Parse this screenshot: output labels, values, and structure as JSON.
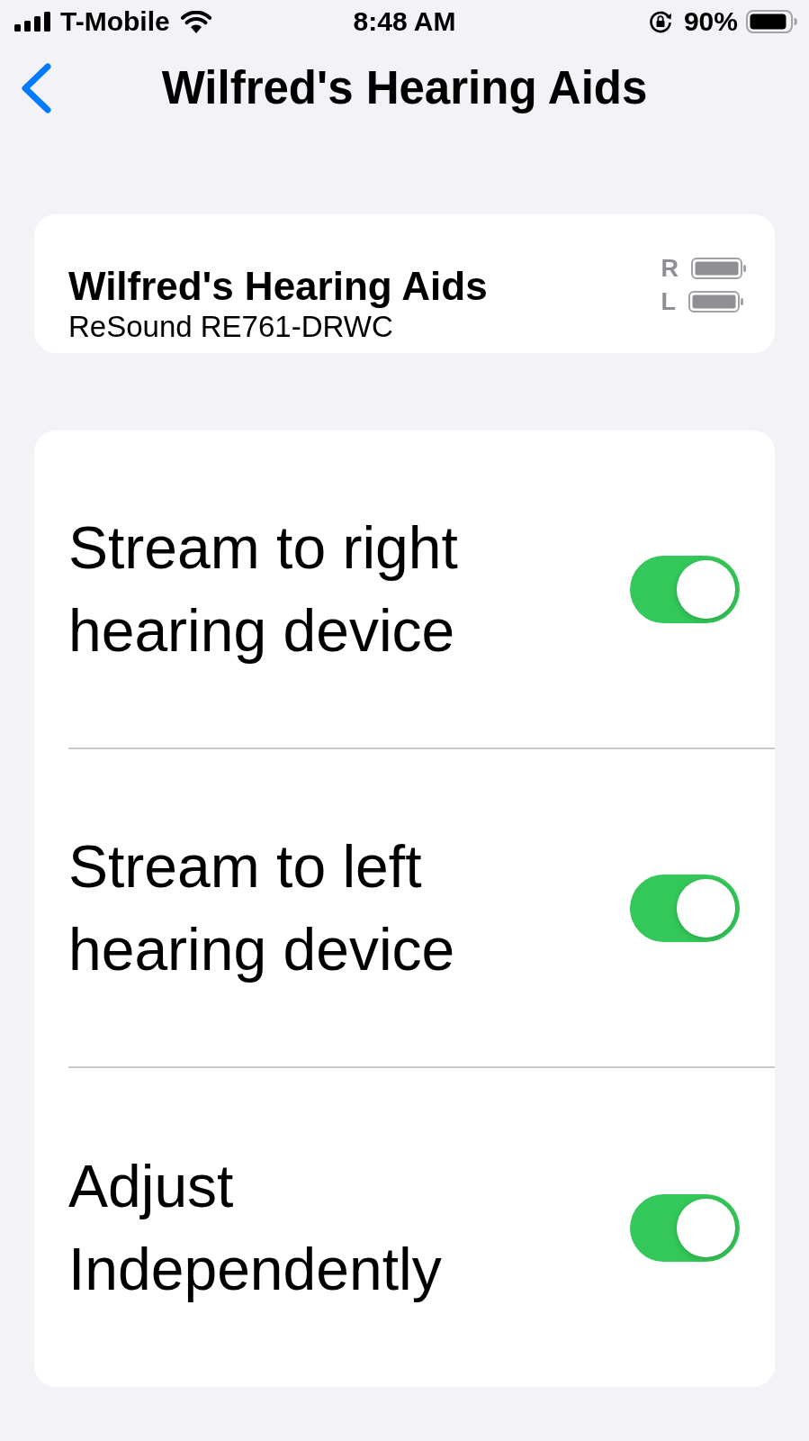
{
  "status_bar": {
    "carrier": "T-Mobile",
    "time": "8:48 AM",
    "battery_percent": "90%"
  },
  "nav": {
    "title": "Wilfred's Hearing Aids"
  },
  "device": {
    "name": "Wilfred's Hearing Aids",
    "model": "ReSound RE761-DRWC",
    "batteries": [
      {
        "label": "R"
      },
      {
        "label": "L"
      }
    ]
  },
  "settings": [
    {
      "label": "Stream to right hearing device",
      "on": true
    },
    {
      "label": "Stream to left hearing device",
      "on": true
    },
    {
      "label": "Adjust Independently",
      "on": true
    }
  ]
}
